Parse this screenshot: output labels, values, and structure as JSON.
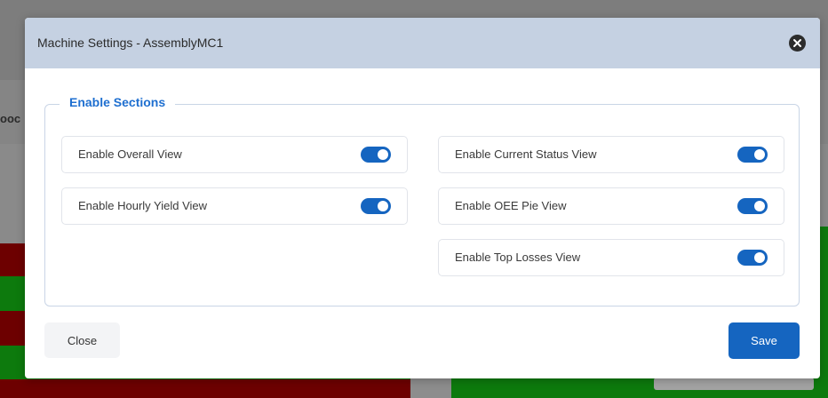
{
  "background": {
    "partial_text": "ooc",
    "colors": {
      "red": "#6d0000",
      "green": "#0d7a0d"
    }
  },
  "modal": {
    "title": "Machine Settings - AssemblyMC1",
    "close_icon": "close-circle-icon",
    "section_legend": "Enable Sections",
    "options": [
      {
        "label": "Enable Overall View",
        "enabled": true
      },
      {
        "label": "Enable Current Status View",
        "enabled": true
      },
      {
        "label": "Enable Hourly Yield View",
        "enabled": true
      },
      {
        "label": "Enable OEE Pie View",
        "enabled": true
      },
      {
        "label": "Enable Top Losses View",
        "enabled": true
      }
    ],
    "close_label": "Close",
    "save_label": "Save",
    "colors": {
      "accent": "#1565c0",
      "legend": "#1e6fd0",
      "header": "#c5d1e2"
    }
  }
}
